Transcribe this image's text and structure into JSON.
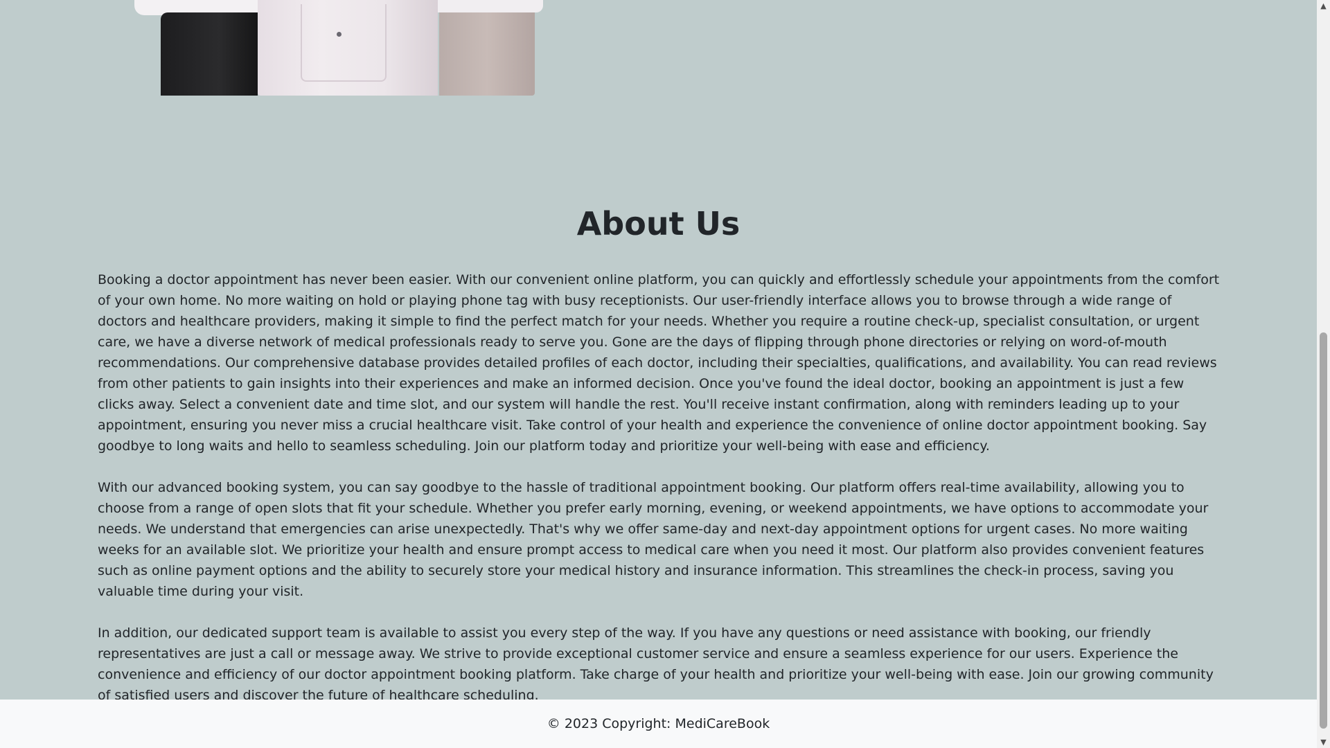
{
  "about": {
    "title": "About Us",
    "paragraphs": [
      "Booking a doctor appointment has never been easier. With our convenient online platform, you can quickly and effortlessly schedule your appointments from the comfort of your own home. No more waiting on hold or playing phone tag with busy receptionists. Our user-friendly interface allows you to browse through a wide range of doctors and healthcare providers, making it simple to find the perfect match for your needs. Whether you require a routine check-up, specialist consultation, or urgent care, we have a diverse network of medical professionals ready to serve you. Gone are the days of flipping through phone directories or relying on word-of-mouth recommendations. Our comprehensive database provides detailed profiles of each doctor, including their specialties, qualifications, and availability. You can read reviews from other patients to gain insights into their experiences and make an informed decision. Once you've found the ideal doctor, booking an appointment is just a few clicks away. Select a convenient date and time slot, and our system will handle the rest. You'll receive instant confirmation, along with reminders leading up to your appointment, ensuring you never miss a crucial healthcare visit. Take control of your health and experience the convenience of online doctor appointment booking. Say goodbye to long waits and hello to seamless scheduling. Join our platform today and prioritize your well-being with ease and efficiency.",
      "With our advanced booking system, you can say goodbye to the hassle of traditional appointment booking. Our platform offers real-time availability, allowing you to choose from a range of open slots that fit your schedule. Whether you prefer early morning, evening, or weekend appointments, we have options to accommodate your needs. We understand that emergencies can arise unexpectedly. That's why we offer same-day and next-day appointment options for urgent cases. No more waiting weeks for an available slot. We prioritize your health and ensure prompt access to medical care when you need it most. Our platform also provides convenient features such as online payment options and the ability to securely store your medical history and insurance information. This streamlines the check-in process, saving you valuable time during your visit.",
      "In addition, our dedicated support team is available to assist you every step of the way. If you have any questions or need assistance with booking, our friendly representatives are just a call or message away. We strive to provide exceptional customer service and ensure a seamless experience for our users. Experience the convenience and efficiency of our doctor appointment booking platform. Take charge of your health and prioritize your well-being with ease. Join our growing community of satisfied users and discover the future of healthcare scheduling."
    ]
  },
  "footer": {
    "copyright": "© 2023 Copyright: MediCareBook"
  },
  "colors": {
    "page_background": "#bfcccc",
    "footer_background": "#f8f9fa",
    "text": "#212529"
  },
  "scrollbar": {
    "up_icon": "arrow-up-icon",
    "down_icon": "arrow-down-icon"
  }
}
